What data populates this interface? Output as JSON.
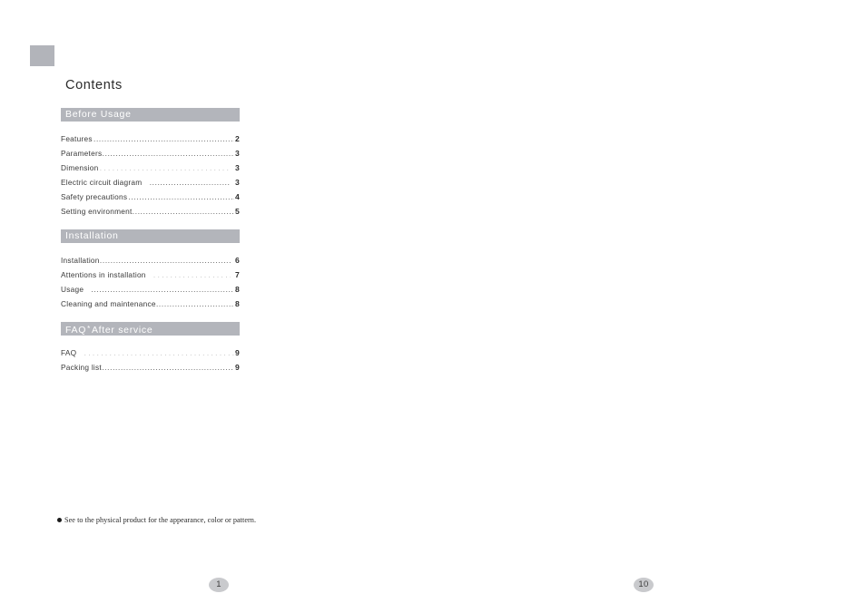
{
  "page": {
    "title": "Contents",
    "folio_left": "1",
    "folio_right": "10"
  },
  "sections": [
    {
      "title": "Before Usage",
      "entries": [
        {
          "label": "Features",
          "page": "2"
        },
        {
          "label": "Parameters",
          "page": "3"
        },
        {
          "label": "Dimension",
          "page": "3"
        },
        {
          "label": "Electric circuit diagram",
          "page": "3"
        },
        {
          "label": "Safety precautions",
          "page": "4"
        },
        {
          "label": "Setting environment",
          "page": "5"
        }
      ]
    },
    {
      "title": "Installation",
      "entries": [
        {
          "label": "Installation",
          "page": "6"
        },
        {
          "label": "Attentions in installation",
          "page": "7"
        },
        {
          "label": "Usage",
          "page": "8"
        },
        {
          "label": "Cleaning and maintenance",
          "page": "8"
        }
      ]
    },
    {
      "title_prefix": "FAQ",
      "title_separator": "*",
      "title_suffix": "After service",
      "title": "FAQ*After service",
      "entries": [
        {
          "label": "FAQ",
          "page": "9"
        },
        {
          "label": "Packing list",
          "page": "9"
        }
      ]
    }
  ],
  "footnote": {
    "text": "See to the physical product for the appearance, color or pattern."
  },
  "colors": {
    "section_bar": "#b3b5bb",
    "corner_block": "#b2b4ba",
    "folio_badge": "#c9cacd"
  }
}
